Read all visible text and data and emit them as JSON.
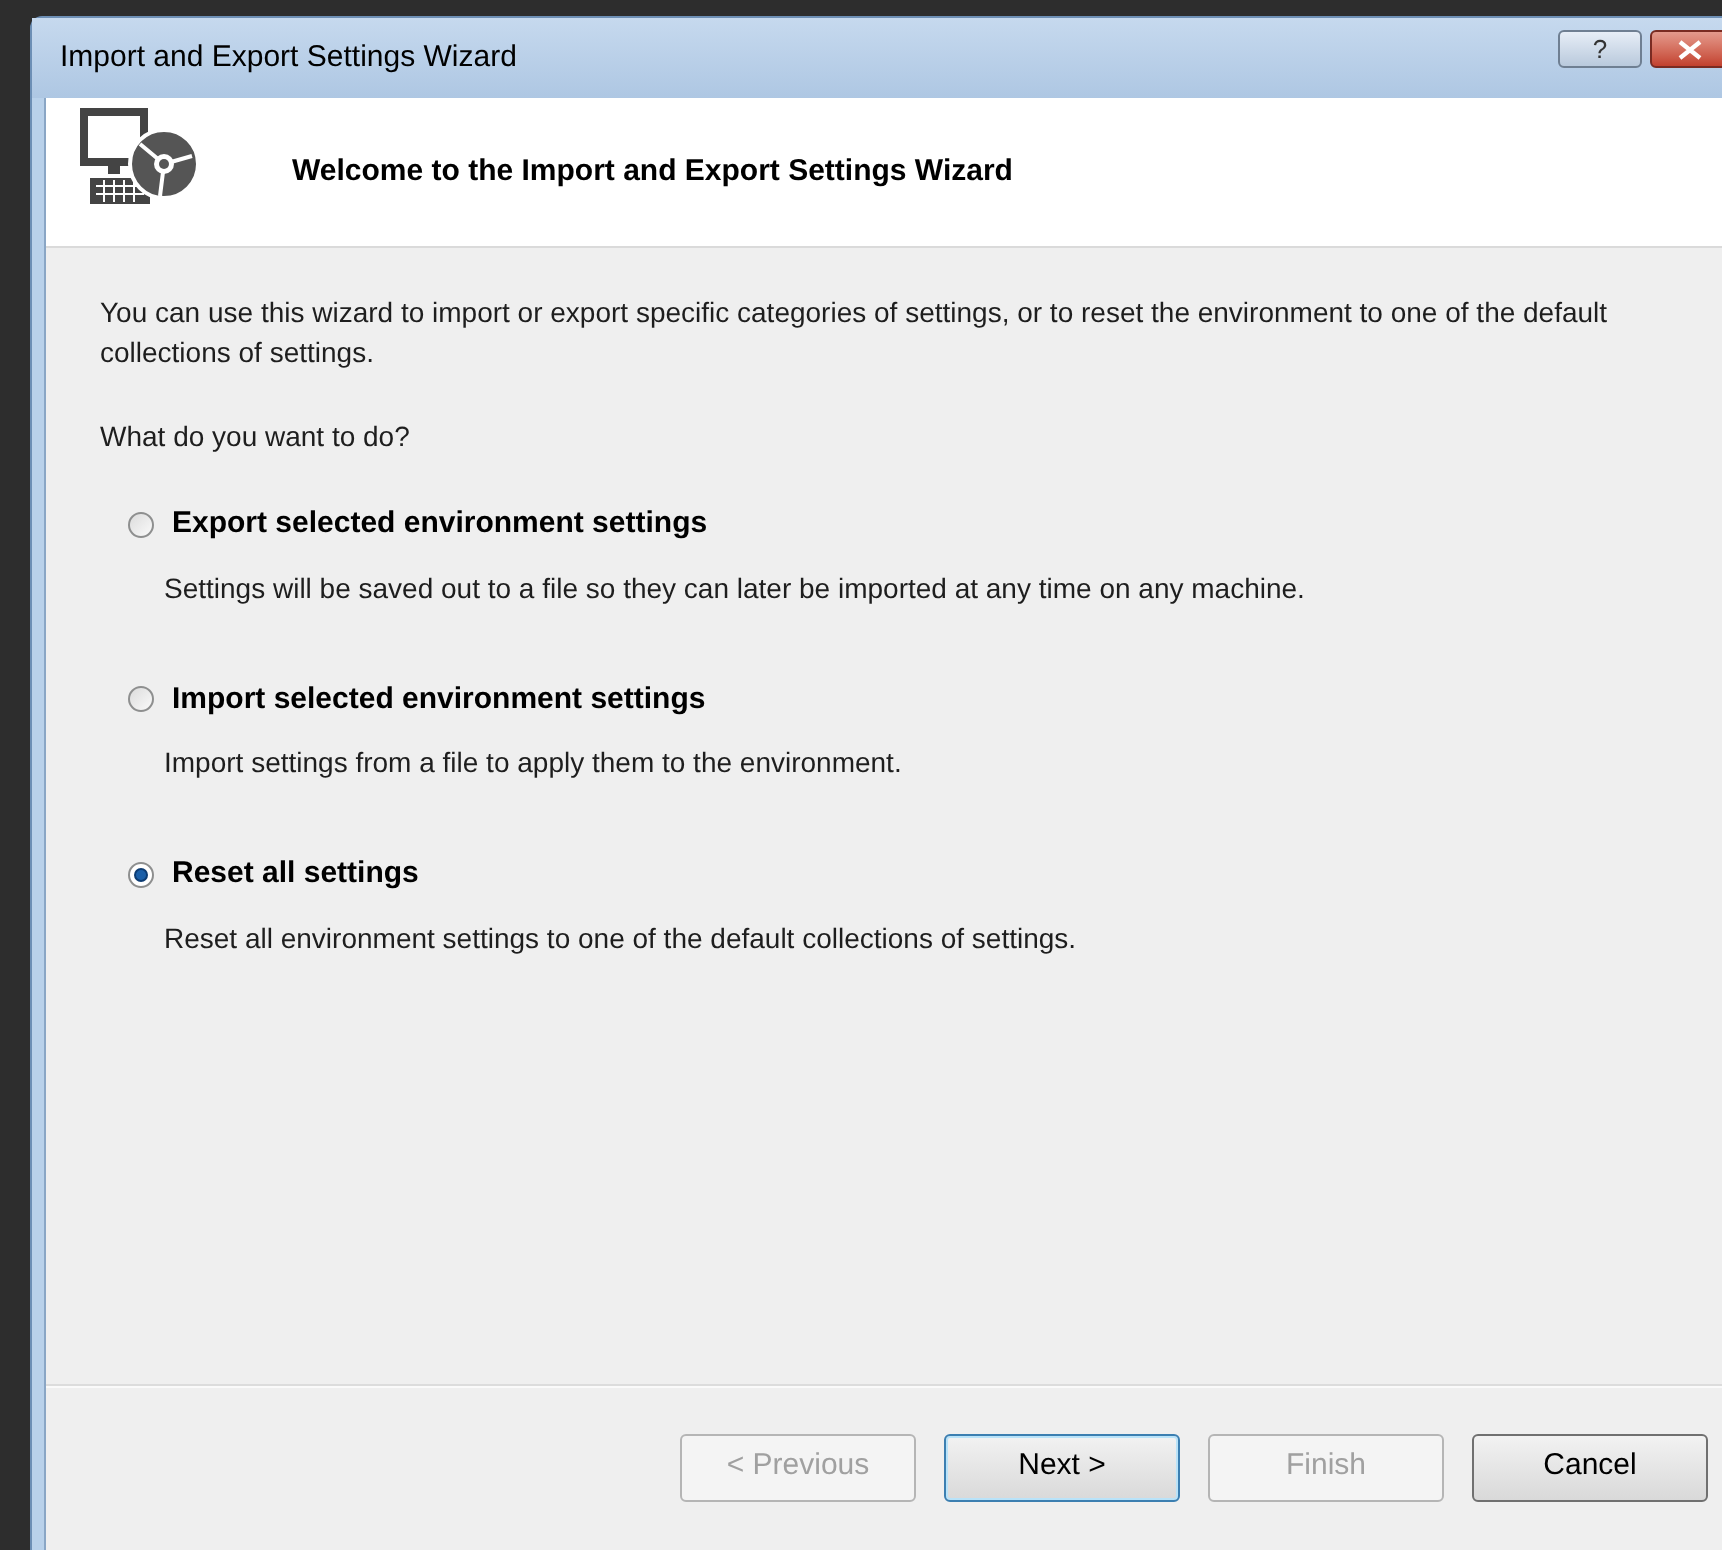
{
  "window": {
    "title": "Import and Export Settings Wizard",
    "help_button": "?"
  },
  "header": {
    "title": "Welcome to the Import and Export Settings Wizard"
  },
  "intro": "You can use this wizard to import or export specific categories of settings, or to reset the environment to one of the default collections of settings.",
  "question": "What do you want to do?",
  "options": [
    {
      "label": "Export selected environment settings",
      "description": "Settings will be saved out to a file so they can later be imported at any time on any machine.",
      "selected": false
    },
    {
      "label": "Import selected environment settings",
      "description": "Import settings from a file to apply them to the environment.",
      "selected": false
    },
    {
      "label": "Reset all settings",
      "description": "Reset all environment settings to one of the default collections of settings.",
      "selected": true
    }
  ],
  "buttons": [
    {
      "label": "< Previous",
      "disabled": true,
      "default": false
    },
    {
      "label": "Next >",
      "disabled": false,
      "default": true
    },
    {
      "label": "Finish",
      "disabled": true,
      "default": false
    },
    {
      "label": "Cancel",
      "disabled": false,
      "default": false
    }
  ]
}
